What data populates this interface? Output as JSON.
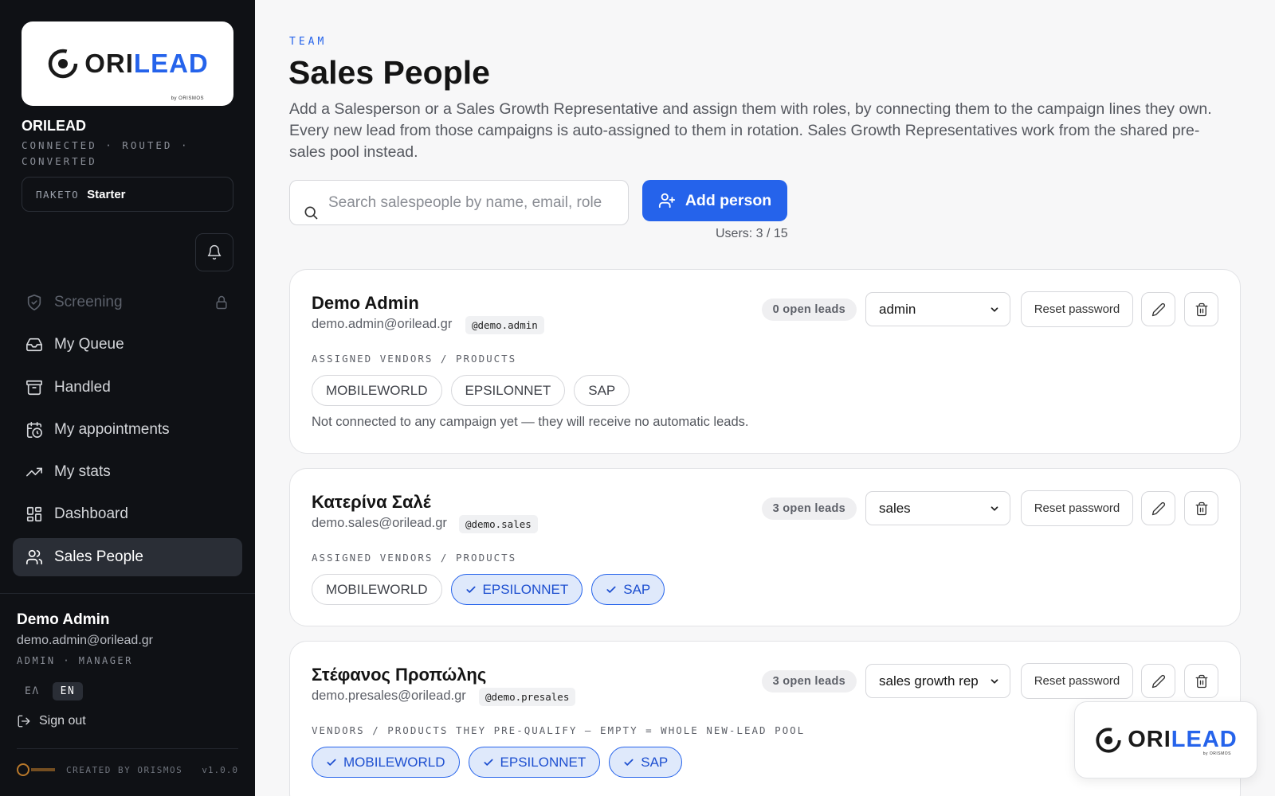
{
  "brand": {
    "logo_ori": "ORI",
    "logo_lead": "LEAD",
    "logo_sub": "by ORISMOS",
    "name": "ORILEAD",
    "tagline": "CONNECTED · ROUTED · CONVERTED",
    "plan_label": "ПАКЕТО",
    "plan_value": "Starter"
  },
  "nav": {
    "items": [
      {
        "label": "Screening",
        "icon": "shield-icon",
        "state": "disabled"
      },
      {
        "label": "My Queue",
        "icon": "inbox-icon",
        "state": ""
      },
      {
        "label": "Handled",
        "icon": "archive-icon",
        "state": ""
      },
      {
        "label": "My appointments",
        "icon": "calendar-clock-icon",
        "state": ""
      },
      {
        "label": "My stats",
        "icon": "trending-up-icon",
        "state": ""
      },
      {
        "label": "Dashboard",
        "icon": "dashboard-icon",
        "state": ""
      },
      {
        "label": "Sales People",
        "icon": "users-icon",
        "state": "active"
      }
    ]
  },
  "user": {
    "name": "Demo Admin",
    "email": "demo.admin@orilead.gr",
    "role": "ADMIN · MANAGER",
    "lang_el": "ΕΛ",
    "lang_en": "EN",
    "signout": "Sign out"
  },
  "footer": {
    "created_by": "CREATED BY ORISMOS",
    "version": "v1.0.0"
  },
  "page": {
    "eyebrow": "TEAM",
    "title": "Sales People",
    "description": "Add a Salesperson or a Sales Growth Representative and assign them with roles, by connecting them to the campaign lines they own. Every new lead from those campaigns is auto-assigned to them in rotation. Sales Growth Representatives work from the shared pre-sales pool instead.",
    "search_placeholder": "Search salespeople by name, email, role",
    "add_button": "Add person",
    "users_count": "Users: 3 / 15"
  },
  "people": [
    {
      "name": "Demo Admin",
      "email": "demo.admin@orilead.gr",
      "handle": "@demo.admin",
      "open_leads": "0 open leads",
      "role": "admin",
      "reset": "Reset password",
      "section_label": "ASSIGNED VENDORS / PRODUCTS",
      "chips": [
        {
          "label": "MOBILEWORLD",
          "on": false
        },
        {
          "label": "EPSILONNET",
          "on": false
        },
        {
          "label": "SAP",
          "on": false
        }
      ],
      "note": "Not connected to any campaign yet — they will receive no automatic leads."
    },
    {
      "name": "Κατερίνα Σαλέ",
      "email": "demo.sales@orilead.gr",
      "handle": "@demo.sales",
      "open_leads": "3 open leads",
      "role": "sales",
      "reset": "Reset password",
      "section_label": "ASSIGNED VENDORS / PRODUCTS",
      "chips": [
        {
          "label": "MOBILEWORLD",
          "on": false
        },
        {
          "label": "EPSILONNET",
          "on": true
        },
        {
          "label": "SAP",
          "on": true
        }
      ],
      "note": ""
    },
    {
      "name": "Στέφανος Προπώλης",
      "email": "demo.presales@orilead.gr",
      "handle": "@demo.presales",
      "open_leads": "3 open leads",
      "role": "sales growth rep",
      "reset": "Reset password",
      "section_label": "VENDORS / PRODUCTS THEY PRE-QUALIFY — EMPTY = WHOLE NEW-LEAD POOL",
      "chips": [
        {
          "label": "MOBILEWORLD",
          "on": true
        },
        {
          "label": "EPSILONNET",
          "on": true
        },
        {
          "label": "SAP",
          "on": true
        }
      ],
      "note": ""
    }
  ],
  "colors": {
    "accent": "#2563eb",
    "sidebar_bg": "#0f1115",
    "chip_on_bg": "#dfe9fb"
  }
}
